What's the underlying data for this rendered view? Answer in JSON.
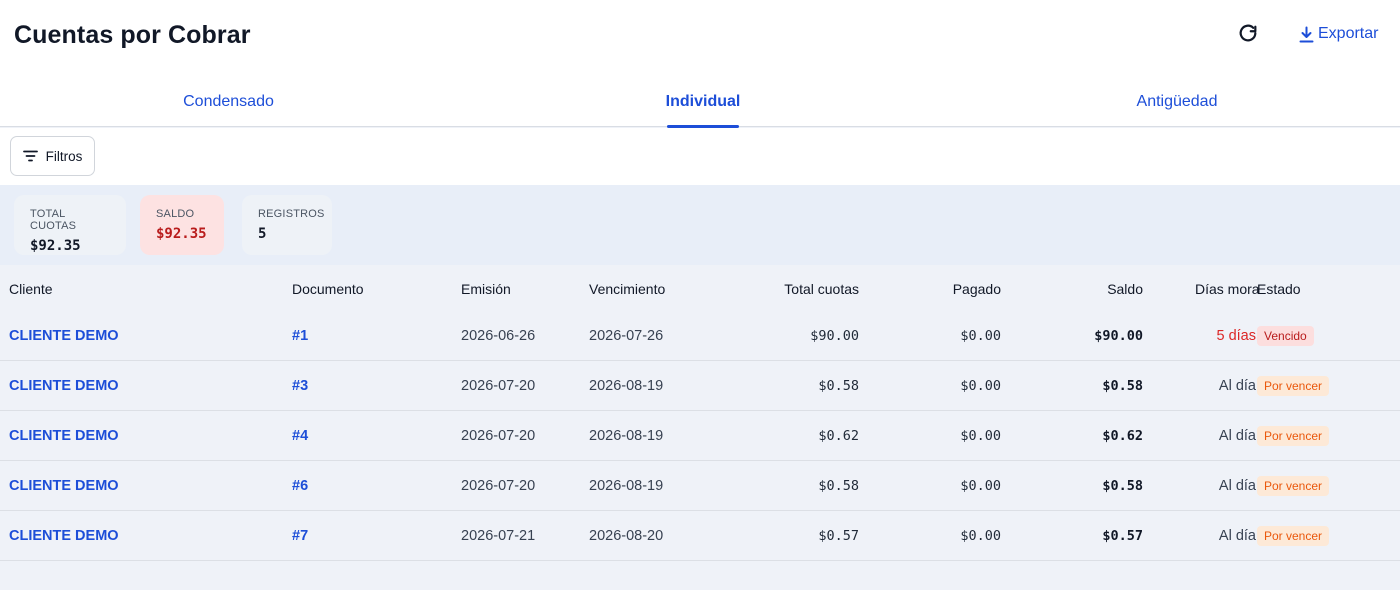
{
  "header": {
    "title": "Cuentas por Cobrar",
    "export_label": "Exportar"
  },
  "tabs": [
    {
      "label": "Condensado"
    },
    {
      "label": "Individual"
    },
    {
      "label": "Antigüedad"
    }
  ],
  "filters": {
    "label": "Filtros"
  },
  "summary": {
    "total_cuotas": {
      "label": "TOTAL CUOTAS",
      "value": "$92.35"
    },
    "saldo": {
      "label": "SALDO",
      "value": "$92.35"
    },
    "registros": {
      "label": "REGISTROS",
      "value": "5"
    }
  },
  "table": {
    "columns": [
      "Cliente",
      "Documento",
      "Emisión",
      "Vencimiento",
      "Total cuotas",
      "Pagado",
      "Saldo",
      "Días mora",
      "Estado"
    ],
    "rows": [
      {
        "cliente": "CLIENTE DEMO",
        "documento": "#1",
        "emision": "2026-06-26",
        "vencimiento": "2026-07-26",
        "total": "$90.00",
        "pagado": "$0.00",
        "saldo": "$90.00",
        "mora": "5 días",
        "estado": "Vencido"
      },
      {
        "cliente": "CLIENTE DEMO",
        "documento": "#3",
        "emision": "2026-07-20",
        "vencimiento": "2026-08-19",
        "total": "$0.58",
        "pagado": "$0.00",
        "saldo": "$0.58",
        "mora": "Al día",
        "estado": "Por vencer"
      },
      {
        "cliente": "CLIENTE DEMO",
        "documento": "#4",
        "emision": "2026-07-20",
        "vencimiento": "2026-08-19",
        "total": "$0.62",
        "pagado": "$0.00",
        "saldo": "$0.62",
        "mora": "Al día",
        "estado": "Por vencer"
      },
      {
        "cliente": "CLIENTE DEMO",
        "documento": "#6",
        "emision": "2026-07-20",
        "vencimiento": "2026-08-19",
        "total": "$0.58",
        "pagado": "$0.00",
        "saldo": "$0.58",
        "mora": "Al día",
        "estado": "Por vencer"
      },
      {
        "cliente": "CLIENTE DEMO",
        "documento": "#7",
        "emision": "2026-07-21",
        "vencimiento": "2026-08-20",
        "total": "$0.57",
        "pagado": "$0.00",
        "saldo": "$0.57",
        "mora": "Al día",
        "estado": "Por vencer"
      }
    ]
  },
  "colors": {
    "accent": "#1d4ed8",
    "danger": "#dc2626",
    "warning": "#ea580c"
  },
  "icons": {
    "refresh": "refresh-icon",
    "export": "download-icon",
    "filter": "filter-icon"
  }
}
